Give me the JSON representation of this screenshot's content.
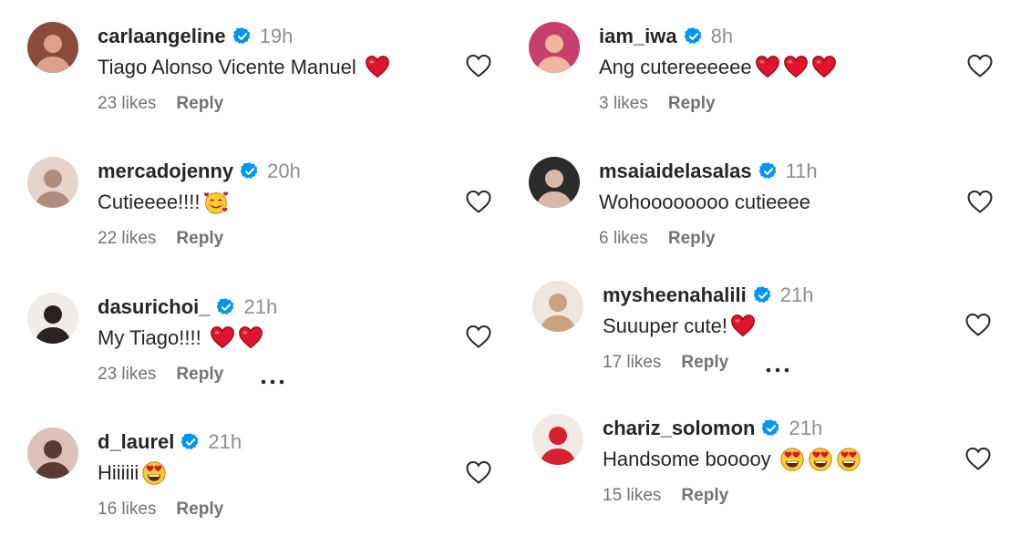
{
  "comments": [
    {
      "username": "carlaangeline",
      "time": "19h",
      "text": "Tiago Alonso Vicente Manuel ",
      "emojis": [
        "heart"
      ],
      "likes": "23 likes",
      "reply": "Reply",
      "more": false,
      "avatar_bg": "#8a4a3c",
      "avatar_fg": "#d9a38b"
    },
    {
      "username": "mercadojenny",
      "time": "20h",
      "text": "Cutieeee!!!!",
      "emojis": [
        "smiling-hearts"
      ],
      "likes": "22 likes",
      "reply": "Reply",
      "more": false,
      "avatar_bg": "#e6d4cb",
      "avatar_fg": "#b08c7c"
    },
    {
      "username": "dasurichoi_",
      "time": "21h",
      "text": "My Tiago!!!! ",
      "emojis": [
        "heart",
        "heart"
      ],
      "likes": "23 likes",
      "reply": "Reply",
      "more": true,
      "avatar_bg": "#f0ece8",
      "avatar_fg": "#2a2220"
    },
    {
      "username": "d_laurel",
      "time": "21h",
      "text": "Hiiiiii",
      "emojis": [
        "heart-eyes"
      ],
      "likes": "16 likes",
      "reply": "Reply",
      "more": false,
      "avatar_bg": "#dcc1b8",
      "avatar_fg": "#5a3a33"
    },
    {
      "username": "iam_iwa",
      "time": "8h",
      "text": "Ang cutereeeeee",
      "emojis": [
        "heart",
        "heart",
        "heart"
      ],
      "likes": "3 likes",
      "reply": "Reply",
      "more": false,
      "avatar_bg": "#c7406d",
      "avatar_fg": "#f2b5a0"
    },
    {
      "username": "msaiaidelasalas",
      "time": "11h",
      "text": "Wohoooooooo cutieeee",
      "emojis": [],
      "likes": "6 likes",
      "reply": "Reply",
      "more": false,
      "avatar_bg": "#2b2b2b",
      "avatar_fg": "#d9b8a8"
    },
    {
      "username": "mysheenahalili",
      "time": "21h",
      "text": "Suuuper cute!",
      "emojis": [
        "heart"
      ],
      "likes": "17 likes",
      "reply": "Reply",
      "more": true,
      "avatar_bg": "#eee6df",
      "avatar_fg": "#c9a27f"
    },
    {
      "username": "chariz_solomon",
      "time": "21h",
      "text": "Handsome booooy ",
      "emojis": [
        "heart-eyes",
        "heart-eyes",
        "heart-eyes"
      ],
      "likes": "15 likes",
      "reply": "Reply",
      "more": false,
      "avatar_bg": "#f2ebe5",
      "avatar_fg": "#d42030"
    }
  ],
  "colors": {
    "verified": "#0095f6",
    "heart_emoji": "#e0142a",
    "text": "#262626",
    "muted": "#8e8e8e"
  }
}
